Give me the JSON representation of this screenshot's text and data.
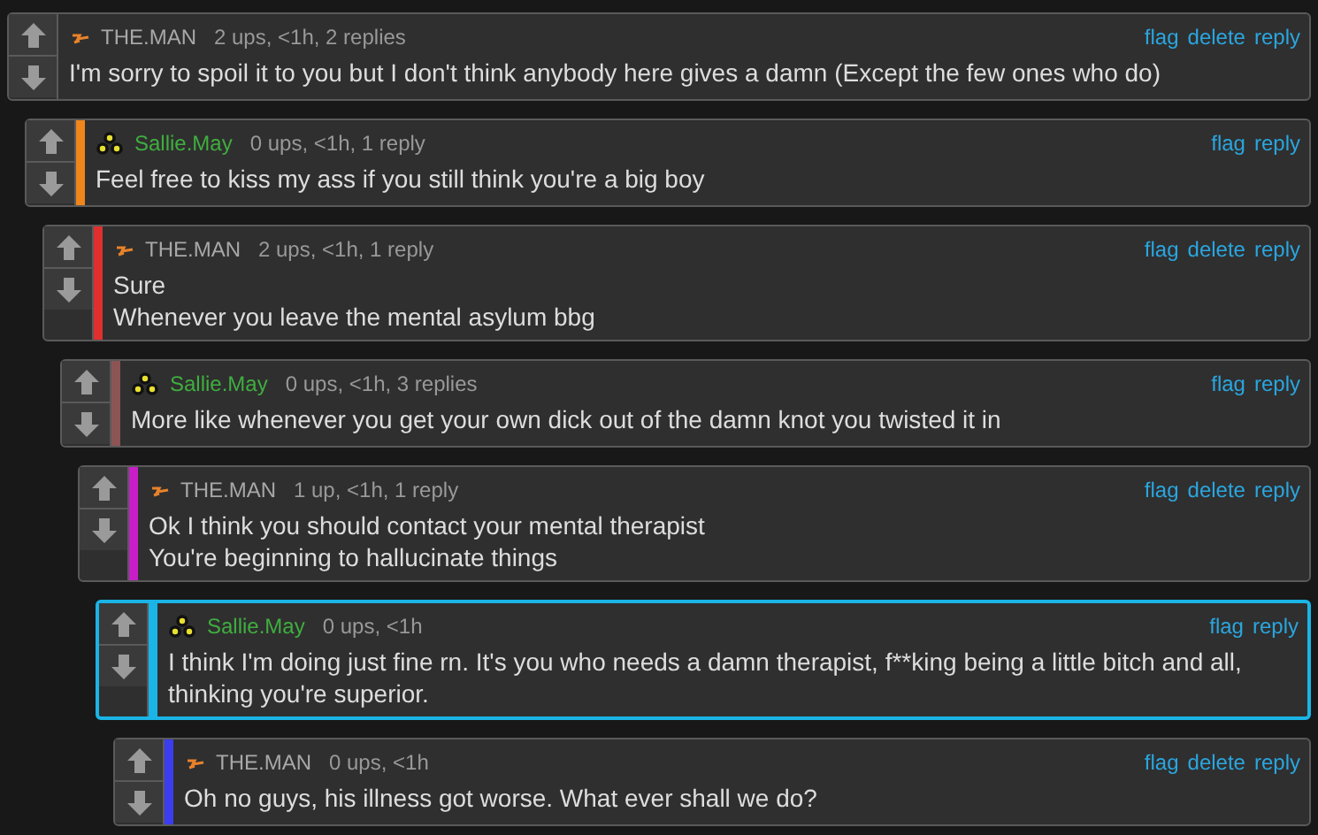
{
  "comments": [
    {
      "user": "THE.MAN",
      "kind": "bolt",
      "highlighted": false,
      "meta": "2 ups, <1h, 2 replies",
      "actions": [
        "flag",
        "delete",
        "reply"
      ],
      "text": [
        "I'm sorry to spoil it to you but I don't think anybody here gives a damn (Except the few ones who do)"
      ],
      "children": [
        {
          "user": "Sallie.May",
          "kind": "stars",
          "color": "#f0851a",
          "highlighted": false,
          "meta": "0 ups, <1h, 1 reply",
          "actions": [
            "flag",
            "reply"
          ],
          "text": [
            "Feel free to kiss my ass if you still think you're a big boy"
          ],
          "children": [
            {
              "user": "THE.MAN",
              "kind": "bolt",
              "color": "#e02f2f",
              "highlighted": false,
              "meta": "2 ups, <1h, 1 reply",
              "actions": [
                "flag",
                "delete",
                "reply"
              ],
              "text": [
                "Sure",
                "Whenever you leave the mental asylum bbg"
              ],
              "children": [
                {
                  "user": "Sallie.May",
                  "kind": "stars",
                  "color": "#8c5454",
                  "highlighted": false,
                  "meta": "0 ups, <1h, 3 replies",
                  "actions": [
                    "flag",
                    "reply"
                  ],
                  "text": [
                    "More like whenever you get your own dick out of the damn knot you twisted it in"
                  ],
                  "children": [
                    {
                      "user": "THE.MAN",
                      "kind": "bolt",
                      "color": "#c81ec8",
                      "highlighted": false,
                      "meta": "1 up, <1h, 1 reply",
                      "actions": [
                        "flag",
                        "delete",
                        "reply"
                      ],
                      "text": [
                        "Ok I think you should contact your mental therapist",
                        "You're beginning to hallucinate things"
                      ],
                      "children": [
                        {
                          "user": "Sallie.May",
                          "kind": "stars",
                          "color": "#1ab4e6",
                          "highlighted": true,
                          "meta": "0 ups, <1h",
                          "actions": [
                            "flag",
                            "reply"
                          ],
                          "text": [
                            "I think I'm doing just fine rn. It's you who needs a damn therapist, f**king being a little bitch and all, thinking you're superior."
                          ],
                          "children": [
                            {
                              "user": "THE.MAN",
                              "kind": "bolt",
                              "color": "#3c3cf0",
                              "highlighted": false,
                              "meta": "0 ups, <1h",
                              "actions": [
                                "flag",
                                "delete",
                                "reply"
                              ],
                              "text": [
                                "Oh no guys, his illness got worse. What ever shall we do?"
                              ]
                            }
                          ]
                        }
                      ]
                    }
                  ]
                }
              ]
            }
          ]
        }
      ]
    }
  ]
}
